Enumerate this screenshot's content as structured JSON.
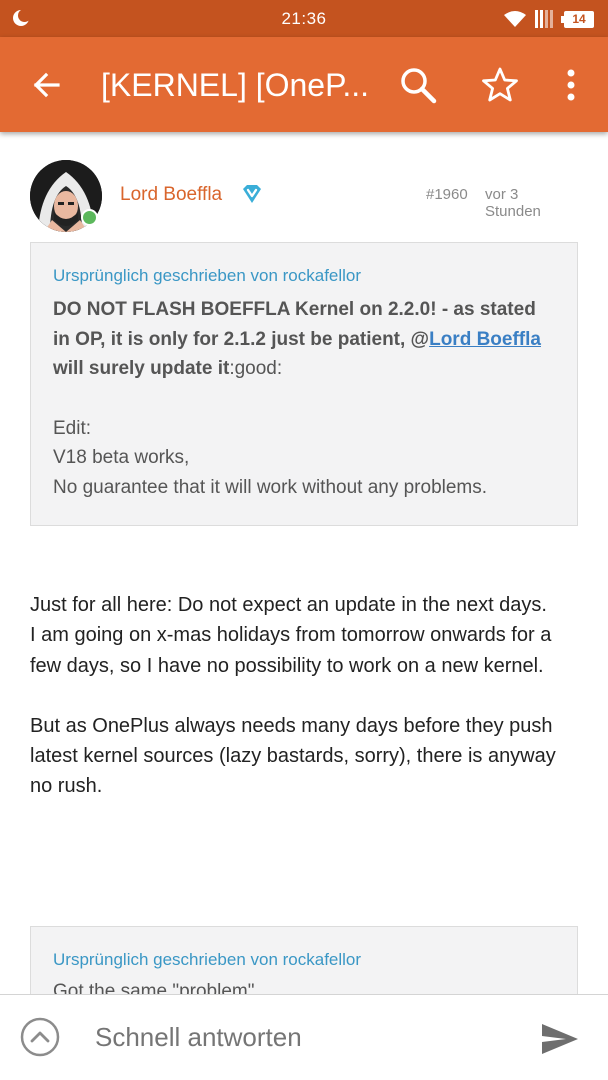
{
  "status_bar": {
    "time": "21:36",
    "battery": "14",
    "icons": [
      "moon-icon",
      "wifi-icon",
      "signal-icon",
      "battery-icon"
    ]
  },
  "app_bar": {
    "title": "[KERNEL] [OneP...",
    "icons": [
      "back-arrow-icon",
      "search-icon",
      "star-icon",
      "more-vert-icon"
    ],
    "color": "#e36a33"
  },
  "post": {
    "author": "Lord Boeffla",
    "number": "#1960",
    "time": "vor 3 Stunden",
    "quote1": {
      "header": "Ursprünglich geschrieben von rockafellor",
      "bold_part1": "DO NOT FLASH BOEFFLA Kernel on 2.2.0! - as stated in OP, it is only for 2.1.2 just be patient, @",
      "mention": "Lord Boeffla",
      "bold_part2": " will surely update it",
      "trail": ":good:",
      "edit_lines": [
        "Edit:",
        "V18 beta works,",
        "No guarantee that it will work without any problems."
      ]
    },
    "message": {
      "p1_lines": [
        "Just for all here: Do not expect an update in the next days.",
        "I am going on x-mas holidays from tomorrow onwards for a few days, so I have no possibility to work on a new kernel."
      ],
      "p2": "But as OnePlus always needs many days before they push latest kernel sources (lazy bastards, sorry), there is anyway no rush."
    },
    "quote2": {
      "header": "Ursprünglich geschrieben von rockafellor",
      "cut_text": "Got the same \"problem\""
    }
  },
  "reply": {
    "placeholder": "Schnell antworten"
  }
}
